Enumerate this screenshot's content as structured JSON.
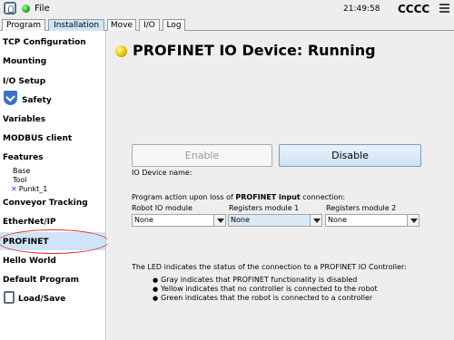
{
  "titlebar": {
    "file_label": "File",
    "clock": "21:49:58",
    "robot_name": "CCCC"
  },
  "tabs": [
    "Program",
    "Installation",
    "Move",
    "I/O",
    "Log"
  ],
  "sidebar": {
    "items": [
      "TCP Configuration",
      "Mounting",
      "I/O Setup",
      "Safety",
      "Variables",
      "MODBUS client",
      "Features",
      "Conveyor Tracking",
      "EtherNet/IP",
      "PROFINET",
      "Hello World",
      "Default Program",
      "Load/Save"
    ],
    "features_children": [
      "Base",
      "Tool",
      "Punkt_1"
    ],
    "selected": "PROFINET"
  },
  "main": {
    "title": "PROFINET IO Device: Running",
    "enable_label": "Enable",
    "disable_label": "Disable",
    "device_name_label": "IO Device name:",
    "action_text_prefix": "Program action upon loss of",
    "action_text_bold": "PROFINET input",
    "action_text_suffix": "connection:",
    "columns": [
      {
        "label": "Robot IO module",
        "value": "None"
      },
      {
        "label": "Registers module 1",
        "value": "None"
      },
      {
        "label": "Registers module 2",
        "value": "None"
      }
    ],
    "led_intro": "The LED indicates the status of the connection to a PROFINET IO Controller:",
    "led_states": [
      "Gray indicates that PROFINET functionality is disabled",
      "Yellow indicates that no controller is connected to the robot",
      "Green indicates that the robot is connected to a controller"
    ]
  }
}
